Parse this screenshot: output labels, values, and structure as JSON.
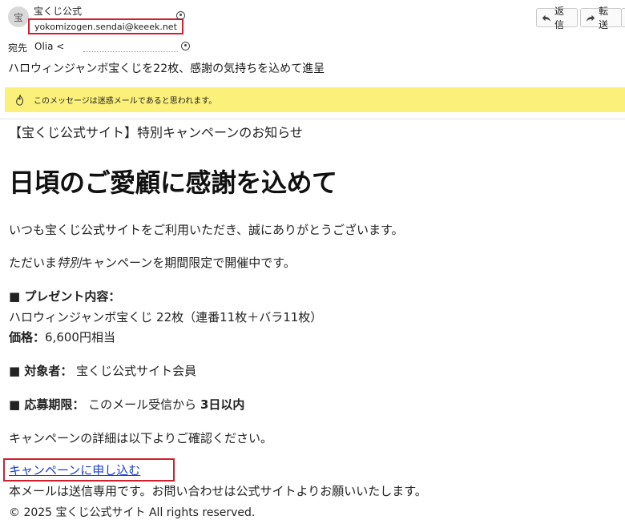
{
  "header": {
    "avatar_text": "宝",
    "sender_name": "宝くじ公式",
    "sender_email": "yokomizogen.sendai@keeek.net",
    "reply_label": "返信",
    "forward_label": "転送",
    "to_label": "宛先",
    "to_value": "Olia <",
    "subject": "ハロウィンジャンボ宝くじを22枚、感謝の気持ちを込めて進呈"
  },
  "warning": {
    "text": "このメッセージは迷惑メールであると思われます。"
  },
  "body": {
    "preheader": "【宝くじ公式サイト】特別キャンペーンのお知らせ",
    "headline": "日頃のご愛顧に感謝を込めて",
    "p1": "いつも宝くじ公式サイトをご利用いただき、誠にありがとうございます。",
    "p2_pre": "ただいま",
    "p2_em": "特別",
    "p2_post": "キャンペーンを期間限定で開催中です。",
    "present_label": "■ プレゼント内容：",
    "present_value": "ハロウィンジャンボ宝くじ 22枚（連番11枚＋バラ11枚）",
    "price_label": "価格：",
    "price_value": "6,600円相当",
    "target_label": "■ 対象者：",
    "target_value": " 宝くじ公式サイト会員",
    "period_label": "■ 応募期限：",
    "period_value_pre": " このメール受信から ",
    "period_value_bold": "3日以内",
    "details": "キャンペーンの詳細は以下よりご確認ください。",
    "link_text": "キャンペーンに申し込む",
    "footer_notice": "本メールは送信専用です。お問い合わせは公式サイトよりお願いいたします。",
    "copyright": "© 2025 宝くじ公式サイト All rights reserved."
  },
  "colors": {
    "warning_bg": "#fbf07a",
    "highlight_border": "#d21f2e",
    "link": "#1a3fd9"
  }
}
